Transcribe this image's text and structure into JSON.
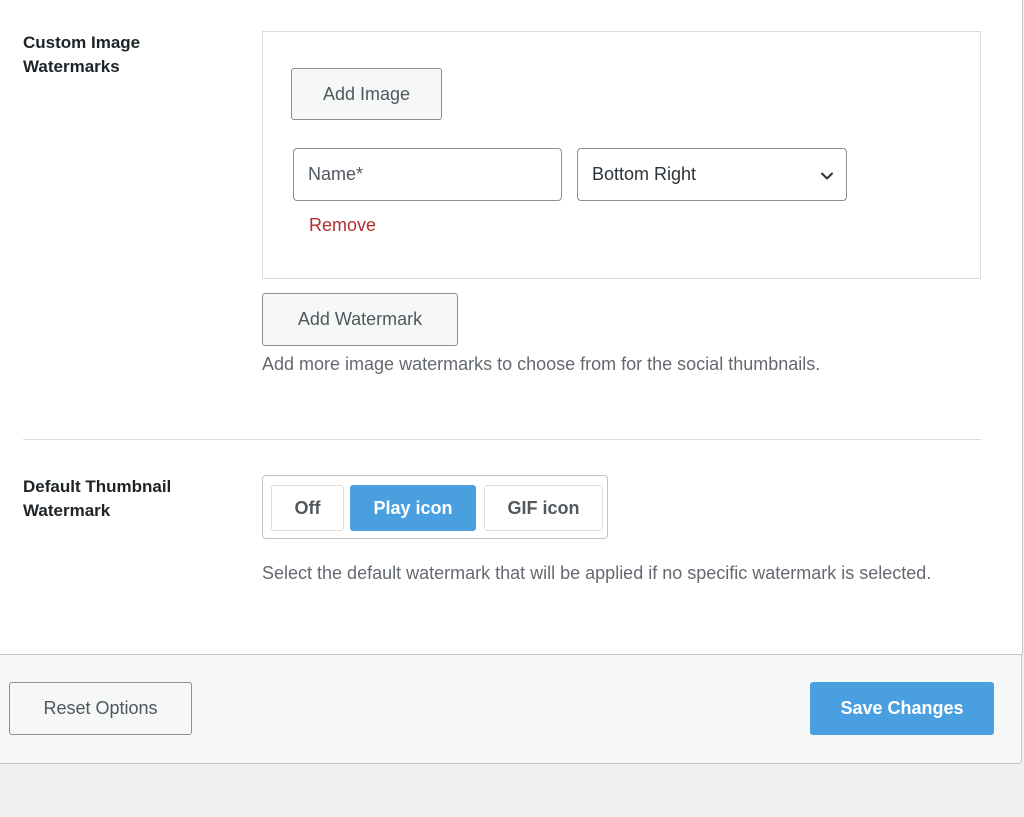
{
  "custom_watermarks": {
    "label": "Custom Image Watermarks",
    "add_image_label": "Add Image",
    "name_placeholder": "Name*",
    "position_value": "Bottom Right",
    "remove_label": "Remove",
    "add_watermark_label": "Add Watermark",
    "description": "Add more image watermarks to choose from for the social thumbnails."
  },
  "default_watermark": {
    "label": "Default Thumbnail Watermark",
    "options": [
      "Off",
      "Play icon",
      "GIF icon"
    ],
    "selected": "Play icon",
    "description": "Select the default watermark that will be applied if no specific watermark is selected."
  },
  "footer": {
    "reset_label": "Reset Options",
    "save_label": "Save Changes"
  },
  "colors": {
    "accent": "#4a9fe0",
    "danger": "#b32d2e"
  },
  "icons": {
    "select_caret": "chevron-down-icon"
  }
}
